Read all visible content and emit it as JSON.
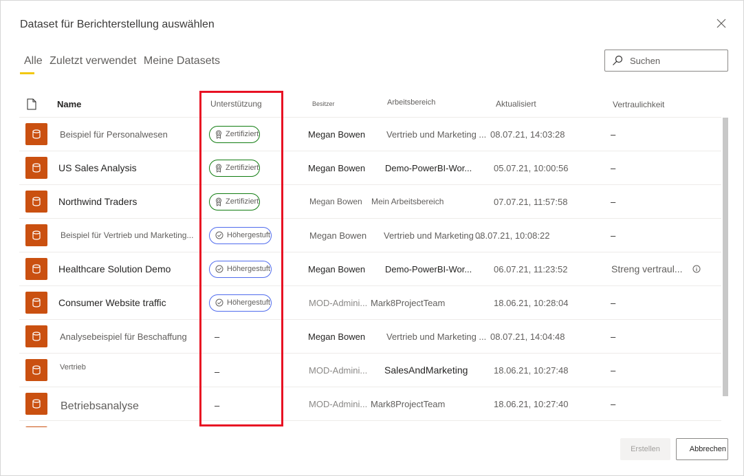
{
  "dialog": {
    "title": "Dataset für Berichterstellung auswählen",
    "close_icon": "close-icon"
  },
  "tabs": [
    {
      "label": "Alle",
      "active": true
    },
    {
      "label": "Zuletzt verwendet",
      "active": false
    },
    {
      "label": "Meine Datasets",
      "active": false
    }
  ],
  "search": {
    "placeholder": "Suchen",
    "value": "",
    "icon": "search-icon"
  },
  "table": {
    "columns": {
      "type_icon": "file-icon",
      "name": "Name",
      "endorsement": "Unterstützung",
      "owner": "Besitzer",
      "workspace": "Arbeitsbereich",
      "refreshed": "Aktualisiert",
      "sensitivity": "Vertraulichkeit"
    },
    "rows": [
      {
        "name": "Beispiel für Personalwesen",
        "endorsement": "Zertifiziert",
        "endorsement_type": "certified",
        "owner": "Megan Bowen",
        "workspace": "Vertrieb und Marketing ...",
        "refreshed": "08.07.21, 14:03:28",
        "sensitivity": "–"
      },
      {
        "name": "US Sales Analysis",
        "endorsement": "Zertifiziert",
        "endorsement_type": "certified",
        "owner": "Megan Bowen",
        "workspace": "Demo-PowerBI-Wor...",
        "refreshed": "05.07.21, 10:00:56",
        "sensitivity": "–"
      },
      {
        "name": "Northwind Traders",
        "endorsement": "Zertifiziert",
        "endorsement_type": "certified",
        "owner": "Megan Bowen",
        "workspace": "Mein Arbeitsbereich",
        "refreshed": "07.07.21, 11:57:58",
        "sensitivity": "–"
      },
      {
        "name": "Beispiel für Vertrieb und Marketing...",
        "endorsement": "Höhergestuft",
        "endorsement_type": "promoted",
        "owner": "Megan Bowen",
        "workspace": "Vertrieb und Marketing ...",
        "refreshed": "08.07.21, 10:08:22",
        "sensitivity": "–"
      },
      {
        "name": "Healthcare Solution Demo",
        "endorsement": "Höhergestuft",
        "endorsement_type": "promoted",
        "owner": "Megan Bowen",
        "workspace": "Demo-PowerBI-Wor...",
        "refreshed": "06.07.21, 11:23:52",
        "sensitivity": "Streng vertraul...",
        "sensitivity_info": true
      },
      {
        "name": "Consumer Website traffic",
        "endorsement": "Höhergestuft",
        "endorsement_type": "promoted",
        "owner": "MOD-Admini...",
        "workspace": "Mark8ProjectTeam",
        "refreshed": "18.06.21, 10:28:04",
        "sensitivity": "–"
      },
      {
        "name": "Analysebeispiel für Beschaffung",
        "endorsement": "–",
        "endorsement_type": "none",
        "owner": "Megan Bowen",
        "workspace": "Vertrieb und Marketing ...",
        "refreshed": "08.07.21, 14:04:48",
        "sensitivity": "–"
      },
      {
        "name": "Vertrieb",
        "endorsement": "–",
        "endorsement_type": "none",
        "owner": "MOD-Admini...",
        "workspace": "SalesAndMarketing",
        "refreshed": "18.06.21, 10:27:48",
        "sensitivity": "–"
      },
      {
        "name": "Betriebsanalyse",
        "endorsement": "–",
        "endorsement_type": "none",
        "owner": "MOD-Admini...",
        "workspace": "Mark8ProjectTeam",
        "refreshed": "18.06.21, 10:27:40",
        "sensitivity": "–"
      }
    ]
  },
  "buttons": {
    "create": "Erstellen",
    "create_disabled": true,
    "cancel": "Abbrechen"
  },
  "colors": {
    "accent_tab": "#f2c811",
    "dataset_icon": "#ca5010",
    "certified": "#107c10",
    "promoted": "#4f6bed",
    "highlight": "#e81123"
  }
}
